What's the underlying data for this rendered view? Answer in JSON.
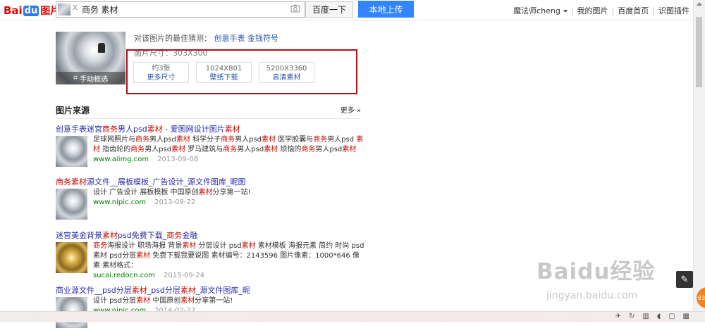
{
  "header": {
    "logo": {
      "bai": "Bai",
      "du": "du",
      "pic": "图片"
    },
    "search": {
      "query": "商务 素材",
      "thumb_remove": "X"
    },
    "search_button": "百度一下",
    "upload_button": "本地上传",
    "nav": {
      "user": "魔法师cheng",
      "my_images": "我的图片",
      "home": "百度首页",
      "plugin": "识图插件"
    }
  },
  "result": {
    "guess_prefix": "对该图片的最佳猜测：",
    "guess_tags": [
      "创意手表",
      "金钱符号"
    ],
    "size_text": "图片尺寸：303X300",
    "crop_label": "手动框选",
    "size_options": [
      {
        "line1": "约3张",
        "line2": "更多尺寸"
      },
      {
        "line1": "1024X801",
        "line2": "壁纸下载"
      },
      {
        "line1": "5200X3360",
        "line2": "高清素材"
      }
    ]
  },
  "sources": {
    "title": "图片来源",
    "more": "更多",
    "items": [
      {
        "title_parts": [
          [
            "创意手表迷宫",
            false
          ],
          [
            "商务",
            true
          ],
          [
            "男人psd",
            false
          ],
          [
            "素材",
            true
          ],
          [
            " - 爱图网设计图片",
            false
          ],
          [
            "素材",
            true
          ]
        ],
        "desc_parts": [
          [
            "足球网照片与",
            false
          ],
          [
            "商务",
            true
          ],
          [
            "男人psd",
            false
          ],
          [
            "素材",
            true
          ],
          [
            " 科学分子",
            false
          ],
          [
            "商务",
            true
          ],
          [
            "男人psd",
            false
          ],
          [
            "素材",
            true
          ],
          [
            " 医学胶囊与",
            false
          ],
          [
            "商务",
            true
          ],
          [
            "男人psd ",
            false
          ],
          [
            "素材",
            true
          ],
          [
            " 指齿轮的",
            false
          ],
          [
            "商务",
            true
          ],
          [
            "男人psd",
            false
          ],
          [
            "素材",
            true
          ],
          [
            " 罗马建筑与",
            false
          ],
          [
            "商务",
            true
          ],
          [
            "男人psd",
            false
          ],
          [
            "素材",
            true
          ],
          [
            " 烦恼的",
            false
          ],
          [
            "商务",
            true
          ],
          [
            "男人psd",
            false
          ],
          [
            "素材",
            true
          ]
        ],
        "url": "www.aiimg.com",
        "date": "2013-09-08",
        "thumb": "silver"
      },
      {
        "title_parts": [
          [
            "商务",
            true
          ],
          [
            "素材",
            true
          ],
          [
            "源文件__展板模板_广告设计_源文件图库_昵图",
            false
          ]
        ],
        "desc_parts": [
          [
            "设计 广告设计 展板模板 中国原创",
            false
          ],
          [
            "素材",
            true
          ],
          [
            "分享第一站!",
            false
          ]
        ],
        "url": "www.nipic.com",
        "date": "2013-09-22",
        "thumb": "silver"
      },
      {
        "title_parts": [
          [
            "迷宫美金背景",
            false
          ],
          [
            "素材",
            true
          ],
          [
            "psd免费下载_",
            false
          ],
          [
            "商务",
            true
          ],
          [
            "金融",
            false
          ]
        ],
        "desc_parts": [
          [
            "商务",
            true
          ],
          [
            "海报设计 职场海报 背景",
            false
          ],
          [
            "素材",
            true
          ],
          [
            " 分层设计 psd",
            false
          ],
          [
            "素材",
            true
          ],
          [
            " 素材模板 海报元素 简约 时尚 psd素材 psd分层",
            false
          ],
          [
            "素材",
            true
          ],
          [
            " 免费下载我要说图 素材编号：2143596 图片像素：1000*646 像素 素材格式：",
            false
          ]
        ],
        "url": "sucai.redocn.com",
        "date": "2015-09-24",
        "thumb": "gold"
      },
      {
        "title_parts": [
          [
            "商业源文件__psd分层",
            false
          ],
          [
            "素材",
            true
          ],
          [
            "_psd分层",
            false
          ],
          [
            "素材",
            true
          ],
          [
            "_源文件图库_昵",
            false
          ]
        ],
        "desc_parts": [
          [
            "设计 psd分层",
            false
          ],
          [
            "素材",
            true
          ],
          [
            " 中国原创",
            false
          ],
          [
            "素材",
            true
          ],
          [
            "分享第一站!",
            false
          ]
        ],
        "url": "www.nipic.com",
        "date": "2014-02-27",
        "thumb": "silver"
      }
    ]
  },
  "watermark": {
    "big": "Baidu经验",
    "small": "jingyan.baidu.com"
  },
  "side": {
    "badge": "83"
  },
  "colors": {
    "highlight_border": "#b1121c",
    "link": "#2a2aa8",
    "keyword": "#c60a00",
    "url": "#008000",
    "upload": "#3385ff"
  }
}
